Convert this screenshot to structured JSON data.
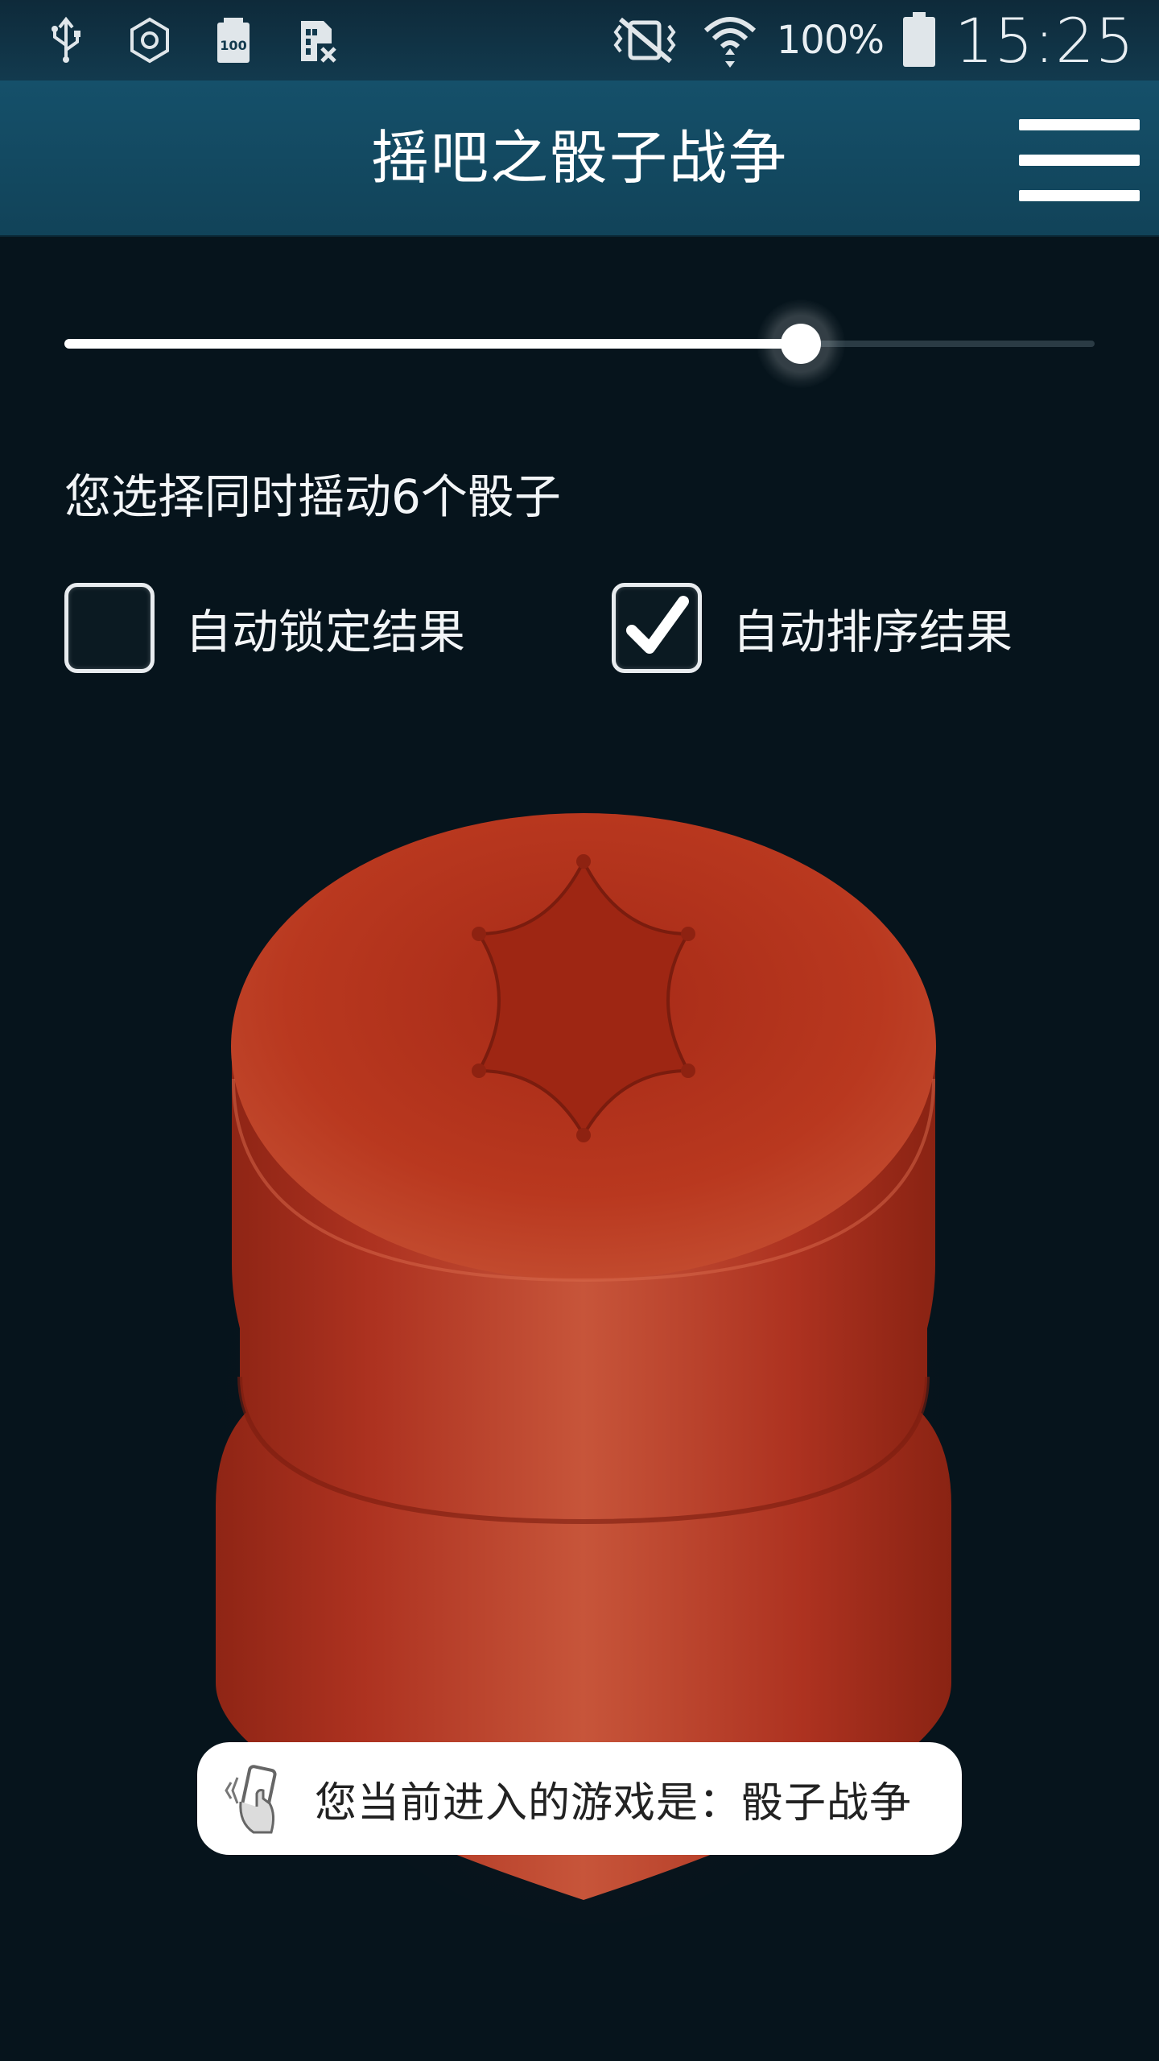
{
  "status_bar": {
    "icons": [
      "usb-icon",
      "hexagon-icon",
      "battery-100-icon",
      "sim-missing-icon",
      "vibrate-mute-icon",
      "wifi-icon",
      "battery-icon"
    ],
    "battery_percent": "100%",
    "time": "15:25"
  },
  "app_bar": {
    "title": "摇吧之骰子战争",
    "menu_icon": "hamburger-menu-icon"
  },
  "settings": {
    "dice_slider_fraction": 0.715,
    "dice_count_label": "您选择同时摇动6个骰子",
    "auto_lock": {
      "label": "自动锁定结果",
      "checked": false
    },
    "auto_sort": {
      "label": "自动排序结果",
      "checked": true
    }
  },
  "toast": {
    "icon": "shaking-phone-icon",
    "text": "您当前进入的游戏是：骰子战争"
  },
  "colors": {
    "background": "#06141c",
    "app_bar": "#15506a",
    "cup_red": "#b5321e"
  }
}
